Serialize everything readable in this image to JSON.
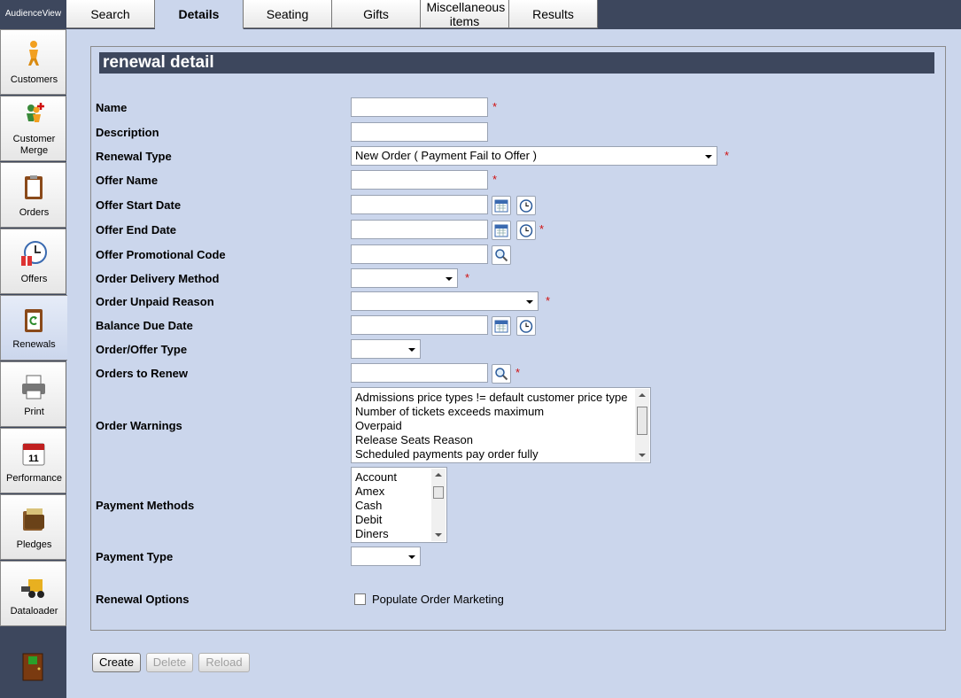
{
  "app": {
    "title": "AudienceView"
  },
  "sidebar": {
    "items": [
      {
        "label": "Customers",
        "icon": "customer-icon"
      },
      {
        "label": "Customer Merge",
        "icon": "customer-merge-icon"
      },
      {
        "label": "Orders",
        "icon": "orders-icon"
      },
      {
        "label": "Offers",
        "icon": "offers-icon"
      },
      {
        "label": "Renewals",
        "icon": "renewals-icon"
      },
      {
        "label": "Print",
        "icon": "printer-icon"
      },
      {
        "label": "Performance",
        "icon": "calendar-icon"
      },
      {
        "label": "Pledges",
        "icon": "wallet-icon"
      },
      {
        "label": "Dataloader",
        "icon": "loader-icon"
      }
    ],
    "exit_icon": "exit-door-icon"
  },
  "tabs": [
    {
      "label": "Search"
    },
    {
      "label": "Details"
    },
    {
      "label": "Seating"
    },
    {
      "label": "Gifts"
    },
    {
      "label": "Miscellaneous items"
    },
    {
      "label": "Results"
    }
  ],
  "section": {
    "title": "renewal detail"
  },
  "form": {
    "required_mark": "*",
    "name": {
      "label": "Name",
      "value": ""
    },
    "description": {
      "label": "Description",
      "value": ""
    },
    "renewal_type": {
      "label": "Renewal Type",
      "value": "New Order ( Payment Fail to Offer )"
    },
    "offer_name": {
      "label": "Offer Name",
      "value": ""
    },
    "offer_start_date": {
      "label": "Offer Start Date",
      "value": ""
    },
    "offer_end_date": {
      "label": "Offer End Date",
      "value": ""
    },
    "offer_promotional_code": {
      "label": "Offer Promotional Code",
      "value": ""
    },
    "order_delivery_method": {
      "label": "Order Delivery Method",
      "value": ""
    },
    "order_unpaid_reason": {
      "label": "Order Unpaid Reason",
      "value": ""
    },
    "balance_due_date": {
      "label": "Balance Due Date",
      "value": ""
    },
    "order_offer_type": {
      "label": "Order/Offer Type",
      "value": ""
    },
    "orders_to_renew": {
      "label": "Orders to Renew",
      "value": ""
    },
    "order_warnings": {
      "label": "Order Warnings",
      "options": [
        "Admissions price types != default customer price type",
        "Number of tickets exceeds maximum",
        "Overpaid",
        "Release Seats Reason",
        "Scheduled payments pay order fully"
      ]
    },
    "payment_methods": {
      "label": "Payment Methods",
      "options": [
        "Account",
        "Amex",
        "Cash",
        "Debit",
        "Diners"
      ]
    },
    "payment_type": {
      "label": "Payment Type",
      "value": ""
    },
    "renewal_options": {
      "label": "Renewal Options",
      "checkbox_label": "Populate Order Marketing",
      "checked": false
    }
  },
  "buttons": {
    "create": "Create",
    "delete": "Delete",
    "reload": "Reload"
  },
  "colors": {
    "chrome": "#3d475d",
    "background": "#cbd6ec",
    "required": "#d01010"
  }
}
